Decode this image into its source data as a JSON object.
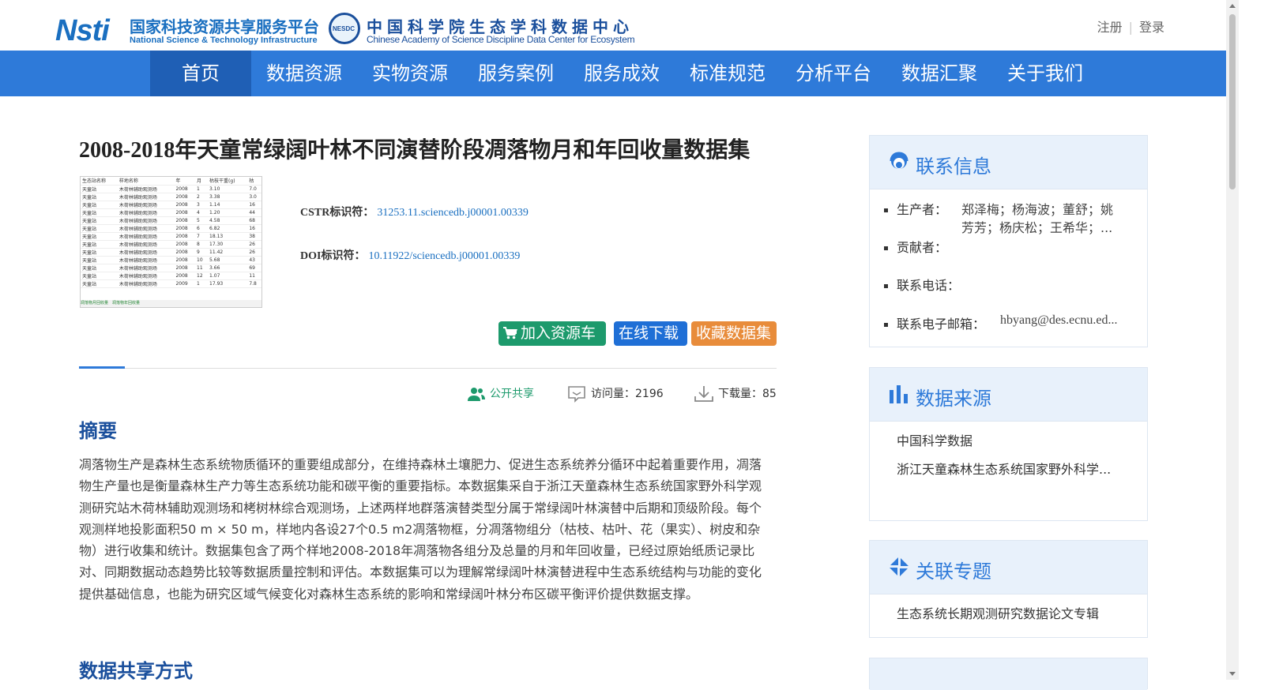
{
  "header": {
    "logo1_mark": "Nsti",
    "logo1_cn": "国家科技资源共享服务平台",
    "logo1_en": "National Science & Technology Infrastructure",
    "logo2_badge": "NESDC",
    "logo2_cn": "中国科学院生态学科数据中心",
    "logo2_en": "Chinese Academy of Science Discipline Data Center for Ecosystem",
    "register": "注册",
    "login": "登录"
  },
  "nav": {
    "items": [
      "首页",
      "数据资源",
      "实物资源",
      "服务案例",
      "服务成效",
      "标准规范",
      "分析平台",
      "数据汇聚",
      "关于我们"
    ],
    "active": "首页"
  },
  "dataset": {
    "title": "2008-2018年天童常绿阔叶林不同演替阶段凋落物月和年回收量数据集",
    "cstr_label": "CSTR标识符：",
    "cstr_value": "31253.11.sciencedb.j00001.00339",
    "doi_label": "DOI标识符：",
    "doi_value": "10.11922/sciencedb.j00001.00339",
    "thumbnail": {
      "headers": [
        "生态站名称",
        "样地名称",
        "年",
        "月",
        "枯枝干重(g)",
        "枯"
      ],
      "rows": [
        [
          "天童站",
          "木荷林辅助观测场",
          "2008",
          "1",
          "3.10",
          "7.0"
        ],
        [
          "天童站",
          "木荷林辅助观测场",
          "2008",
          "2",
          "3.38",
          "3.0"
        ],
        [
          "天童站",
          "木荷林辅助观测场",
          "2008",
          "3",
          "1.14",
          "16"
        ],
        [
          "天童站",
          "木荷林辅助观测场",
          "2008",
          "4",
          "1.20",
          "44"
        ],
        [
          "天童站",
          "木荷林辅助观测场",
          "2008",
          "5",
          "4.58",
          "68"
        ],
        [
          "天童站",
          "木荷林辅助观测场",
          "2008",
          "6",
          "6.82",
          "16"
        ],
        [
          "天童站",
          "木荷林辅助观测场",
          "2008",
          "7",
          "18.13",
          "38"
        ],
        [
          "天童站",
          "木荷林辅助观测场",
          "2008",
          "8",
          "17.30",
          "26"
        ],
        [
          "天童站",
          "木荷林辅助观测场",
          "2008",
          "9",
          "11.42",
          "26"
        ],
        [
          "天童站",
          "木荷林辅助观测场",
          "2008",
          "10",
          "5.68",
          "43"
        ],
        [
          "天童站",
          "木荷林辅助观测场",
          "2008",
          "11",
          "3.66",
          "69"
        ],
        [
          "天童站",
          "木荷林辅助观测场",
          "2008",
          "12",
          "1.07",
          "11"
        ],
        [
          "天童站",
          "木荷林辅助观测场",
          "2009",
          "1",
          "17.93",
          "7.8"
        ]
      ],
      "sheet_tabs": "凋落物月回收量　凋落物年回收量"
    }
  },
  "actions": {
    "cart": "加入资源车",
    "download": "在线下载",
    "favorite": "收藏数据集"
  },
  "stats": {
    "open": "公开共享",
    "visits": "访问量：2196",
    "downloads": "下载量：85"
  },
  "abstract": {
    "heading": "摘要",
    "text": "凋落物生产是森林生态系统物质循环的重要组成部分，在维持森林土壤肥力、促进生态系统养分循环中起着重要作用，凋落物生产量也是衡量森林生产力等生态系统功能和碳平衡的重要指标。本数据集采自于浙江天童森林生态系统国家野外科学观测研究站木荷林辅助观测场和栲树林综合观测场，上述两样地群落演替类型分属于常绿阔叶林演替中后期和顶级阶段。每个观测样地投影面积50 m × 50 m，样地内各设27个0.5 m2凋落物框，分凋落物组分（枯枝、枯叶、花（果实）、树皮和杂物）进行收集和统计。数据集包含了两个样地2008-2018年凋落物各组分及总量的月和年回收量，已经过原始纸质记录比对、同期数据动态趋势比较等数据质量控制和评估。本数据集可以为理解常绿阔叶林演替进程中生态系统结构与功能的变化提供基础信息，也能为研究区域气候变化对森林生态系统的影响和常绿阔叶林分布区碳平衡评价提供数据支撑。",
    "next_heading": "数据共享方式"
  },
  "sidebar": {
    "contact": {
      "title": "联系信息",
      "producer_label": "生产者：",
      "producer_line1": "郑泽梅；杨海波；董舒；姚",
      "producer_line2": "芳芳；杨庆松；王希华；...",
      "contributor_label": "贡献者：",
      "phone_label": "联系电话：",
      "email_label": "联系电子邮箱：",
      "email_value": "hbyang@des.ecnu.ed..."
    },
    "source": {
      "title": "数据来源",
      "line1": "中国科学数据",
      "line2": "浙江天童森林生态系统国家野外科学..."
    },
    "topic": {
      "title": "关联专题",
      "line1": "生态系统长期观测研究数据论文专辑"
    }
  }
}
